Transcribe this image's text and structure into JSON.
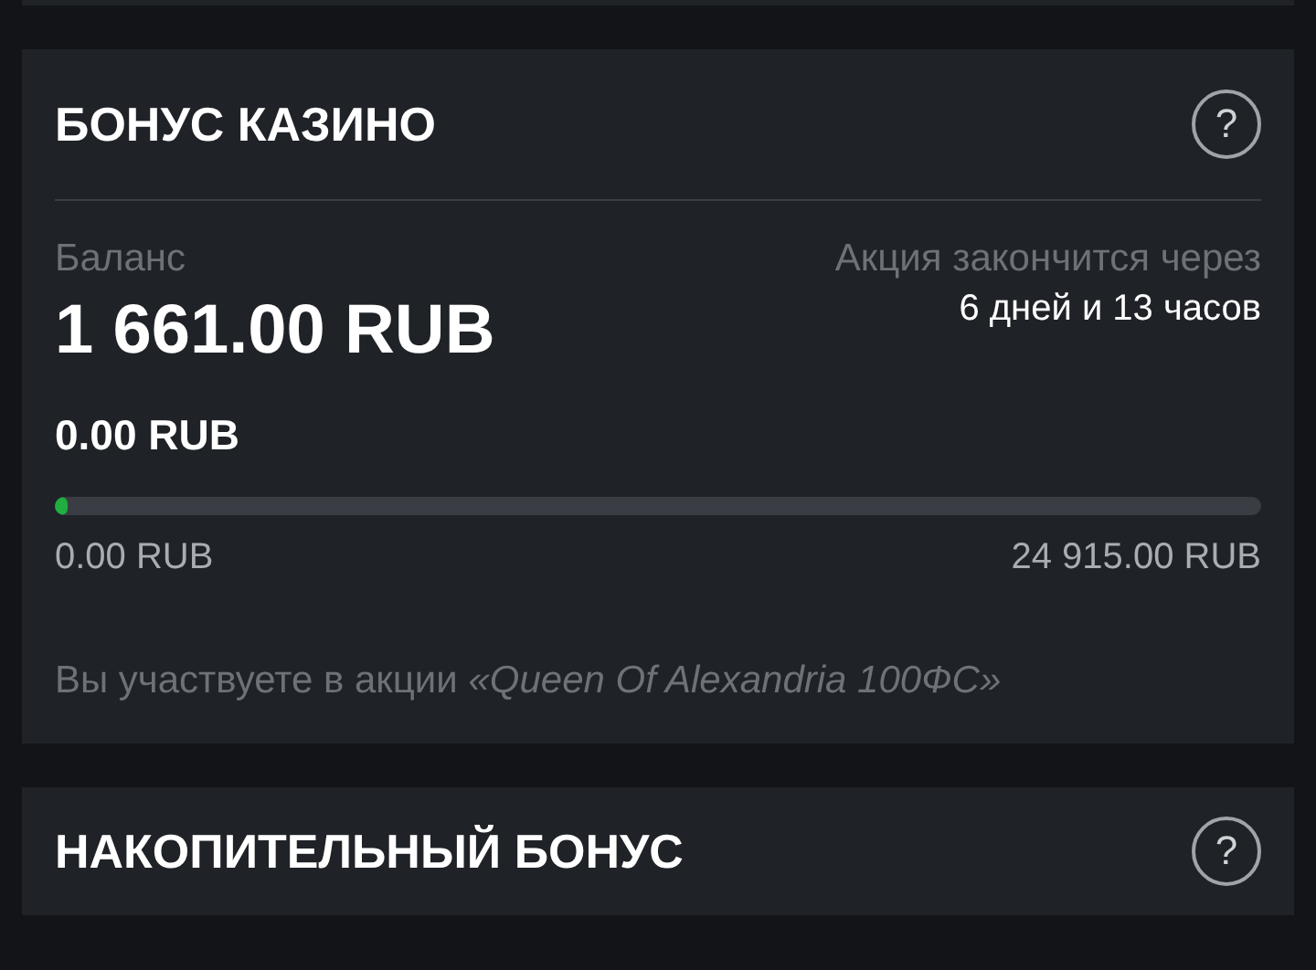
{
  "bonus_card": {
    "title": "БОНУС КАЗИНО",
    "help": "?",
    "balance_label": "Баланс",
    "balance": "1 661.00 RUB",
    "ends_label": "Акция закончится через",
    "ends_value": "6 дней и 13 часов",
    "wagered": "0.00 RUB",
    "progress": {
      "level": 0.01,
      "min": "0.00 RUB",
      "max": "24 915.00 RUB"
    },
    "note": "Вы участвуете в акции *«Queen Of Alexandria 100ФС»*"
  },
  "next_card": {
    "title": "НАКОПИТЕЛЬНЫЙ БОНУС",
    "help": "?"
  }
}
